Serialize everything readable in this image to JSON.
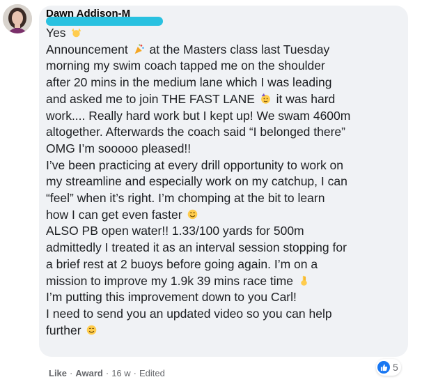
{
  "comment": {
    "author": "Dawn Addison-M",
    "lines": [
      "Yes",
      "Announcement",
      " at the Masters class last Tuesday",
      "morning my swim coach tapped me on the shoulder",
      "after 20 mins in the medium lane which I was leading",
      "and asked me to join THE FAST LANE",
      " it was hard",
      "work.... Really hard work but I kept up! We swam 4600m",
      "altogether. Afterwards the coach said “I belonged there”",
      "OMG I’m sooooo pleased!!",
      "I’ve been practicing at every drill opportunity to work on",
      "my streamline and especially work on my catchup, I can",
      "“feel” when it’s right. I’m chomping at the bit to learn",
      "how I can get even faster",
      "ALSO PB open water!! 1.33/100 yards for 500m",
      "admittedly I treated it as an interval session stopping for",
      "a brief rest at 2 buoys before going again. I’m on a",
      "mission to improve my 1.9k 39 mins race time",
      "I’m putting this improvement down to you Carl!",
      "I need to send you an updated video so you can help",
      "further"
    ]
  },
  "actions": {
    "like": "Like",
    "award": "Award",
    "time": "16 w",
    "edited": "Edited",
    "separator": "·"
  },
  "reactions": {
    "count": "5"
  },
  "colors": {
    "bubble": "#f0f2f5",
    "redaction": "#29c1e0",
    "like_blue": "#1877f2"
  }
}
